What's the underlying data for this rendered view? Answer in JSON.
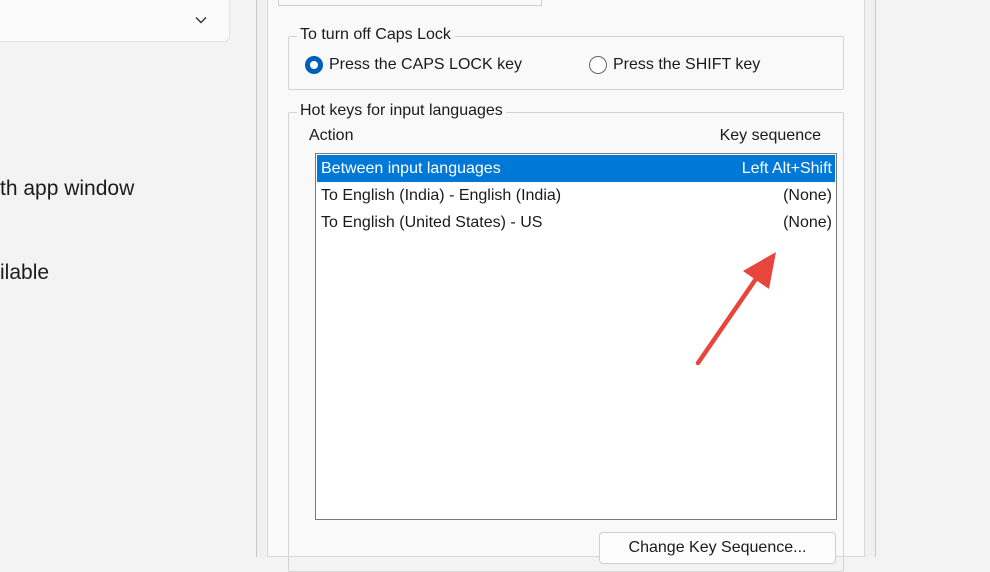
{
  "background": {
    "texts": [
      "th app window",
      "ilable"
    ]
  },
  "dialog": {
    "caps_group": {
      "title": "To turn off Caps Lock",
      "options": [
        {
          "label": "Press the CAPS LOCK key",
          "selected": true
        },
        {
          "label": "Press the SHIFT key",
          "selected": false
        }
      ]
    },
    "hotkeys_group": {
      "title": "Hot keys for input languages",
      "columns": {
        "action": "Action",
        "key": "Key sequence"
      },
      "rows": [
        {
          "action": "Between input languages",
          "key": "Left Alt+Shift",
          "selected": true
        },
        {
          "action": "To English (India) - English (India)",
          "key": "(None)",
          "selected": false
        },
        {
          "action": "To English (United States) - US",
          "key": "(None)",
          "selected": false
        }
      ]
    },
    "change_button": "Change Key Sequence..."
  },
  "colors": {
    "selection": "#0078d7",
    "arrow": "#e8453c",
    "radio_accent": "#005fb8"
  },
  "icons": {
    "dropdown": "chevron-down-icon",
    "annotation": "red-arrow"
  }
}
